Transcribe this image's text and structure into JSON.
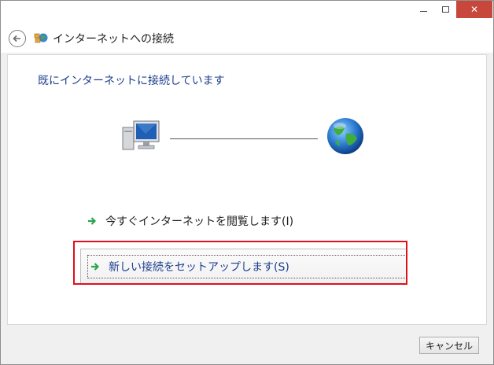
{
  "window": {
    "title": "インターネットへの接続"
  },
  "status": {
    "heading": "既にインターネットに接続しています"
  },
  "options": {
    "browse_label": "今すぐインターネットを閲覧します(I)",
    "new_connection_label": "新しい接続をセットアップします(S)"
  },
  "footer": {
    "cancel_label": "キャンセル"
  },
  "icons": {
    "back": "back-arrow-icon",
    "network": "network-connection-icon",
    "computer": "computer-icon",
    "globe": "globe-icon",
    "arrow": "green-arrow-icon"
  },
  "colors": {
    "heading_text": "#1e3f8e",
    "close_button": "#c7473b",
    "highlight_border": "#e0101a",
    "arrow_green": "#2ea44f"
  }
}
